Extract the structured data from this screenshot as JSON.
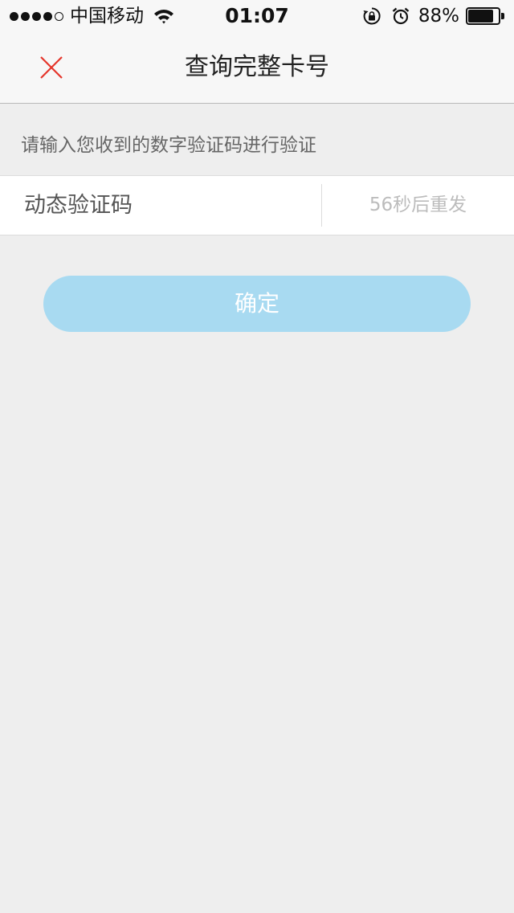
{
  "status_bar": {
    "carrier": "中国移动",
    "time": "01:07",
    "battery_percent": "88%",
    "battery_level": 0.88,
    "signal_bars_filled": 4,
    "signal_bars_total": 5,
    "icons": [
      "wifi-icon",
      "rotation-lock-icon",
      "alarm-icon",
      "battery-icon"
    ]
  },
  "nav": {
    "title": "查询完整卡号",
    "close_icon": "close-icon",
    "close_color": "#e5352b"
  },
  "form": {
    "hint": "请输入您收到的数字验证码进行验证",
    "code_placeholder": "动态验证码",
    "code_value": "",
    "resend_label": "56秒后重发",
    "confirm_label": "确定",
    "confirm_color": "#a8daf1"
  }
}
